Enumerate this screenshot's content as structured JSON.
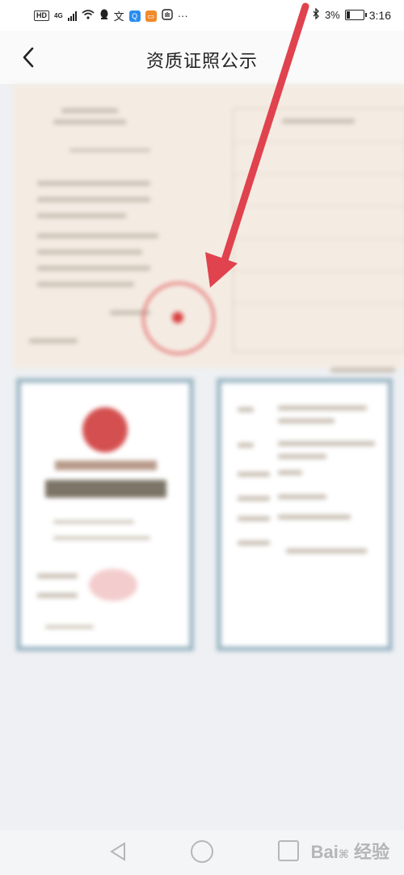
{
  "status_bar": {
    "hd": "HD",
    "network": "4G",
    "battery_text": "3%",
    "time": "3:16",
    "battery_level": 0.2,
    "icons": [
      "signal-icon",
      "wifi-icon",
      "qq-icon",
      "translate-icon",
      "search-app-icon",
      "news-app-icon",
      "hand-icon",
      "more-icon",
      "bluetooth-icon",
      "battery-icon"
    ]
  },
  "header": {
    "title": "资质证照公示",
    "back_icon": "chevron-left-icon"
  },
  "content": {
    "images": [
      "license-certificate-blurred",
      "registration-certificate-blurred",
      "certificate-details-blurred"
    ]
  },
  "nav": {
    "buttons": [
      "back-triangle-icon",
      "home-circle-icon",
      "recents-square-icon"
    ]
  },
  "watermark": "Bai 经验",
  "colors": {
    "arrow": "#e0424e",
    "seal_red": "#d84040",
    "frame_blue": "#9eb8c5",
    "paper": "#f4ece3"
  }
}
